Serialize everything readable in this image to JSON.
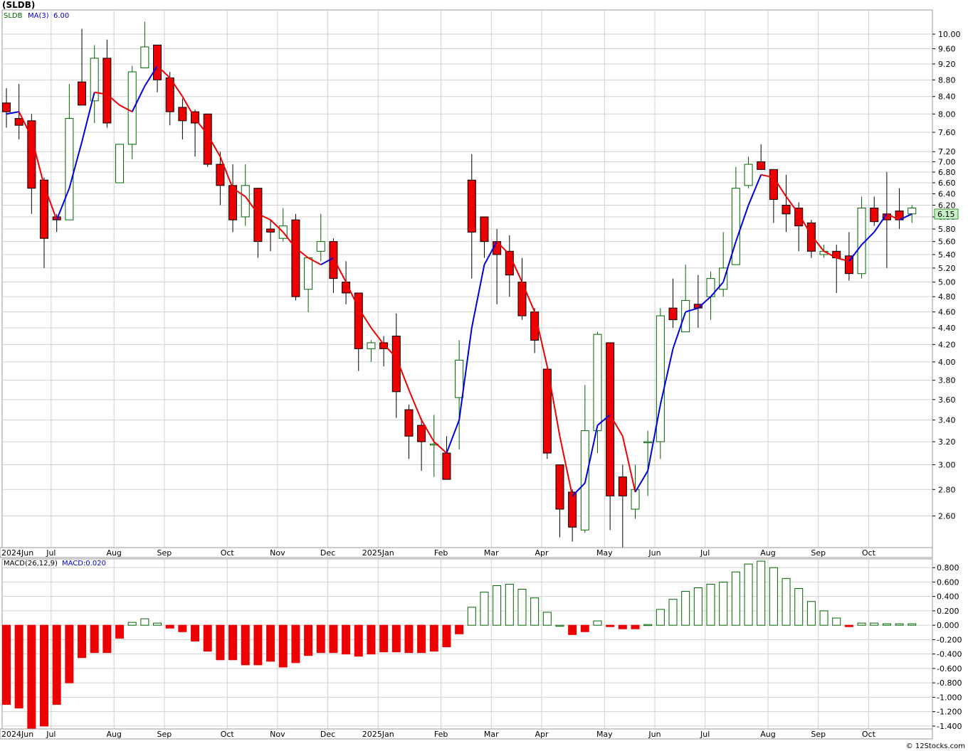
{
  "title": "(SLDB)",
  "credit": "© 12Stocks.com",
  "colors": {
    "up_stroke": "#006400",
    "down_fill": "#ee0000",
    "ma_up": "#0000dd",
    "ma_down": "#ee0000",
    "macd_text": "#0000cc",
    "grid": "#d0d0d0"
  },
  "months": [
    "2024Jun",
    "Jul",
    "Aug",
    "Sep",
    "Oct",
    "Nov",
    "Dec",
    "2025Jan",
    "Feb",
    "Mar",
    "Apr",
    "May",
    "Jun",
    "Jul",
    "Aug",
    "Sep",
    "Oct"
  ],
  "legend": {
    "symbol": "SLDB",
    "ma_label": "MA(3)",
    "ma_value": "6.00",
    "macd_label": "MACD(26,12,9)",
    "macd_value": "MACD:0.020"
  },
  "price_badge": "6.15",
  "chart_data": [
    {
      "type": "candlestick",
      "title": "(SLDB)",
      "y_scale": "log",
      "ylim": [
        2.38,
        10.7
      ],
      "y_ticks": [
        "10.00",
        "9.60",
        "9.20",
        "8.80",
        "8.40",
        "8.00",
        "7.60",
        "7.20",
        "7.00",
        "6.80",
        "6.60",
        "6.40",
        "6.20",
        "6.00",
        "5.80",
        "5.60",
        "5.40",
        "5.20",
        "5.00",
        "4.80",
        "4.60",
        "4.40",
        "4.20",
        "4.00",
        "3.80",
        "3.60",
        "3.40",
        "3.20",
        "3.00",
        "2.80",
        "2.60"
      ],
      "series_ma_name": "MA(3)",
      "candles": [
        {
          "date": "2024-06-03",
          "o": 8.25,
          "h": 8.6,
          "l": 7.7,
          "c": 8.05
        },
        {
          "date": "2024-06-10",
          "o": 7.9,
          "h": 8.7,
          "l": 7.45,
          "c": 7.75
        },
        {
          "date": "2024-06-17",
          "o": 7.85,
          "h": 8.0,
          "l": 6.05,
          "c": 6.5
        },
        {
          "date": "2024-06-24",
          "o": 6.65,
          "h": 6.7,
          "l": 5.2,
          "c": 5.65
        },
        {
          "date": "2024-07-01",
          "o": 6.0,
          "h": 6.05,
          "l": 5.75,
          "c": 5.95
        },
        {
          "date": "2024-07-08",
          "o": 5.95,
          "h": 8.7,
          "l": 5.95,
          "c": 7.9
        },
        {
          "date": "2024-07-15",
          "o": 8.75,
          "h": 10.15,
          "l": 8.2,
          "c": 8.2
        },
        {
          "date": "2024-07-22",
          "o": 8.3,
          "h": 9.7,
          "l": 7.8,
          "c": 9.35
        },
        {
          "date": "2024-07-29",
          "o": 9.35,
          "h": 9.85,
          "l": 7.7,
          "c": 7.8
        },
        {
          "date": "2024-08-05",
          "o": 6.6,
          "h": 7.35,
          "l": 6.6,
          "c": 7.35
        },
        {
          "date": "2024-08-12",
          "o": 7.35,
          "h": 9.15,
          "l": 7.05,
          "c": 9.0
        },
        {
          "date": "2024-08-19",
          "o": 9.1,
          "h": 10.35,
          "l": 9.1,
          "c": 9.65
        },
        {
          "date": "2024-08-26",
          "o": 9.7,
          "h": 9.7,
          "l": 8.5,
          "c": 8.8
        },
        {
          "date": "2024-09-02",
          "o": 8.85,
          "h": 9.0,
          "l": 7.75,
          "c": 8.05
        },
        {
          "date": "2024-09-09",
          "o": 8.15,
          "h": 8.35,
          "l": 7.45,
          "c": 7.85
        },
        {
          "date": "2024-09-16",
          "o": 8.05,
          "h": 8.1,
          "l": 7.1,
          "c": 7.8
        },
        {
          "date": "2024-09-23",
          "o": 8.0,
          "h": 8.0,
          "l": 6.9,
          "c": 6.95
        },
        {
          "date": "2024-09-30",
          "o": 6.95,
          "h": 7.2,
          "l": 6.2,
          "c": 6.55
        },
        {
          "date": "2024-10-07",
          "o": 6.55,
          "h": 6.95,
          "l": 5.75,
          "c": 5.95
        },
        {
          "date": "2024-10-14",
          "o": 6.0,
          "h": 6.95,
          "l": 5.85,
          "c": 6.55
        },
        {
          "date": "2024-10-21",
          "o": 6.5,
          "h": 6.5,
          "l": 5.35,
          "c": 5.6
        },
        {
          "date": "2024-10-28",
          "o": 5.8,
          "h": 5.95,
          "l": 5.45,
          "c": 5.75
        },
        {
          "date": "2024-11-04",
          "o": 5.65,
          "h": 6.15,
          "l": 5.6,
          "c": 5.85
        },
        {
          "date": "2024-11-11",
          "o": 5.95,
          "h": 6.05,
          "l": 4.75,
          "c": 4.8
        },
        {
          "date": "2024-11-18",
          "o": 4.9,
          "h": 5.3,
          "l": 4.6,
          "c": 5.35
        },
        {
          "date": "2024-11-25",
          "o": 5.45,
          "h": 6.05,
          "l": 5.3,
          "c": 5.6
        },
        {
          "date": "2024-12-02",
          "o": 5.6,
          "h": 5.65,
          "l": 4.85,
          "c": 5.05
        },
        {
          "date": "2024-12-09",
          "o": 5.0,
          "h": 5.3,
          "l": 4.7,
          "c": 4.85
        },
        {
          "date": "2024-12-16",
          "o": 4.85,
          "h": 4.85,
          "l": 3.9,
          "c": 4.15
        },
        {
          "date": "2024-12-23",
          "o": 4.15,
          "h": 4.25,
          "l": 4.0,
          "c": 4.22
        },
        {
          "date": "2024-12-30",
          "o": 4.22,
          "h": 4.3,
          "l": 3.95,
          "c": 4.15
        },
        {
          "date": "2025-01-06",
          "o": 4.3,
          "h": 4.58,
          "l": 3.42,
          "c": 3.68
        },
        {
          "date": "2025-01-13",
          "o": 3.5,
          "h": 3.55,
          "l": 3.05,
          "c": 3.25
        },
        {
          "date": "2025-01-20",
          "o": 3.35,
          "h": 3.42,
          "l": 2.95,
          "c": 3.2
        },
        {
          "date": "2025-01-27",
          "o": 3.17,
          "h": 3.45,
          "l": 2.9,
          "c": 3.18
        },
        {
          "date": "2025-02-03",
          "o": 3.1,
          "h": 3.25,
          "l": 2.88,
          "c": 2.88
        },
        {
          "date": "2025-02-10",
          "o": 3.62,
          "h": 4.25,
          "l": 3.13,
          "c": 4.02
        },
        {
          "date": "2025-02-17",
          "o": 6.65,
          "h": 7.15,
          "l": 5.05,
          "c": 5.75
        },
        {
          "date": "2025-02-24",
          "o": 6.0,
          "h": 6.0,
          "l": 5.35,
          "c": 5.6
        },
        {
          "date": "2025-03-03",
          "o": 5.6,
          "h": 5.8,
          "l": 4.7,
          "c": 5.4
        },
        {
          "date": "2025-03-10",
          "o": 5.45,
          "h": 5.7,
          "l": 4.8,
          "c": 5.1
        },
        {
          "date": "2025-03-17",
          "o": 5.0,
          "h": 5.35,
          "l": 4.5,
          "c": 4.55
        },
        {
          "date": "2025-03-24",
          "o": 4.6,
          "h": 4.65,
          "l": 4.1,
          "c": 4.25
        },
        {
          "date": "2025-03-31",
          "o": 3.92,
          "h": 3.92,
          "l": 3.05,
          "c": 3.1
        },
        {
          "date": "2025-04-07",
          "o": 3.0,
          "h": 3.0,
          "l": 2.45,
          "c": 2.65
        },
        {
          "date": "2025-04-14",
          "o": 2.78,
          "h": 2.8,
          "l": 2.42,
          "c": 2.52
        },
        {
          "date": "2025-04-21",
          "o": 2.5,
          "h": 3.75,
          "l": 2.48,
          "c": 3.3
        },
        {
          "date": "2025-04-28",
          "o": 3.3,
          "h": 4.35,
          "l": 3.1,
          "c": 4.32
        },
        {
          "date": "2025-05-05",
          "o": 4.22,
          "h": 4.22,
          "l": 2.5,
          "c": 2.75
        },
        {
          "date": "2025-05-12",
          "o": 2.9,
          "h": 3.0,
          "l": 2.38,
          "c": 2.75
        },
        {
          "date": "2025-05-19",
          "o": 2.65,
          "h": 3.0,
          "l": 2.58,
          "c": 2.8
        },
        {
          "date": "2025-05-26",
          "o": 3.2,
          "h": 3.3,
          "l": 2.75,
          "c": 3.2
        },
        {
          "date": "2025-06-02",
          "o": 3.2,
          "h": 4.65,
          "l": 3.05,
          "c": 4.55
        },
        {
          "date": "2025-06-09",
          "o": 4.65,
          "h": 5.05,
          "l": 4.4,
          "c": 4.5
        },
        {
          "date": "2025-06-16",
          "o": 4.35,
          "h": 5.25,
          "l": 4.35,
          "c": 4.75
        },
        {
          "date": "2025-06-23",
          "o": 4.7,
          "h": 5.1,
          "l": 4.4,
          "c": 4.65
        },
        {
          "date": "2025-06-30",
          "o": 4.8,
          "h": 5.15,
          "l": 4.5,
          "c": 5.05
        },
        {
          "date": "2025-07-07",
          "o": 4.9,
          "h": 5.75,
          "l": 4.8,
          "c": 5.2
        },
        {
          "date": "2025-07-14",
          "o": 5.25,
          "h": 6.9,
          "l": 5.25,
          "c": 6.5
        },
        {
          "date": "2025-07-21",
          "o": 6.55,
          "h": 7.1,
          "l": 6.5,
          "c": 6.95
        },
        {
          "date": "2025-07-28",
          "o": 7.0,
          "h": 7.35,
          "l": 6.85,
          "c": 6.85
        },
        {
          "date": "2025-08-04",
          "o": 6.85,
          "h": 6.85,
          "l": 5.9,
          "c": 6.3
        },
        {
          "date": "2025-08-11",
          "o": 6.2,
          "h": 6.75,
          "l": 5.75,
          "c": 6.05
        },
        {
          "date": "2025-08-18",
          "o": 6.15,
          "h": 6.25,
          "l": 5.45,
          "c": 5.85
        },
        {
          "date": "2025-08-25",
          "o": 5.9,
          "h": 5.95,
          "l": 5.35,
          "c": 5.45
        },
        {
          "date": "2025-09-01",
          "o": 5.4,
          "h": 5.55,
          "l": 5.35,
          "c": 5.45
        },
        {
          "date": "2025-09-08",
          "o": 5.45,
          "h": 5.55,
          "l": 4.85,
          "c": 5.35
        },
        {
          "date": "2025-09-15",
          "o": 5.38,
          "h": 5.75,
          "l": 5.02,
          "c": 5.12
        },
        {
          "date": "2025-09-22",
          "o": 5.12,
          "h": 6.35,
          "l": 5.05,
          "c": 6.15
        },
        {
          "date": "2025-09-29",
          "o": 6.15,
          "h": 6.35,
          "l": 5.85,
          "c": 5.92
        },
        {
          "date": "2025-10-06",
          "o": 6.05,
          "h": 6.8,
          "l": 5.2,
          "c": 5.95
        },
        {
          "date": "2025-10-13",
          "o": 6.1,
          "h": 6.5,
          "l": 5.8,
          "c": 5.95
        },
        {
          "date": "2025-10-20",
          "o": 6.05,
          "h": 6.2,
          "l": 5.9,
          "c": 6.15
        }
      ],
      "ma": [
        8.0,
        8.05,
        7.5,
        6.55,
        5.95,
        6.5,
        7.4,
        8.5,
        8.45,
        8.2,
        8.05,
        8.65,
        9.15,
        8.85,
        8.4,
        7.9,
        7.55,
        7.1,
        6.5,
        6.35,
        6.05,
        5.95,
        5.75,
        5.5,
        5.35,
        5.25,
        5.35,
        5.0,
        4.65,
        4.4,
        4.2,
        4.05,
        3.7,
        3.4,
        3.2,
        3.1,
        3.4,
        4.4,
        5.25,
        5.6,
        5.4,
        5.0,
        4.6,
        3.95,
        3.25,
        2.75,
        2.85,
        3.35,
        3.45,
        3.25,
        2.78,
        2.95,
        3.55,
        4.15,
        4.6,
        4.65,
        4.8,
        5.0,
        5.6,
        6.2,
        6.75,
        6.7,
        6.35,
        6.05,
        5.7,
        5.45,
        5.35,
        5.3,
        5.55,
        5.75,
        6.05,
        5.95,
        6.05
      ]
    },
    {
      "type": "bar",
      "title": "MACD(26,12,9)",
      "ylim": [
        -1.45,
        0.92
      ],
      "y_ticks": [
        "0.800",
        "0.600",
        "0.400",
        "0.200",
        "0.000",
        "-0.200",
        "-0.400",
        "-0.600",
        "-0.800",
        "-1.000",
        "-1.200",
        "-1.400"
      ],
      "values": [
        -1.1,
        -1.15,
        -1.45,
        -1.4,
        -1.1,
        -0.8,
        -0.45,
        -0.38,
        -0.38,
        -0.18,
        0.04,
        0.09,
        0.03,
        -0.04,
        -0.09,
        -0.22,
        -0.36,
        -0.48,
        -0.48,
        -0.55,
        -0.55,
        -0.5,
        -0.58,
        -0.52,
        -0.42,
        -0.38,
        -0.38,
        -0.4,
        -0.43,
        -0.4,
        -0.37,
        -0.37,
        -0.38,
        -0.38,
        -0.36,
        -0.3,
        -0.12,
        0.25,
        0.46,
        0.55,
        0.57,
        0.5,
        0.38,
        0.18,
        0.0,
        -0.13,
        -0.09,
        0.06,
        -0.02,
        -0.05,
        -0.05,
        0.01,
        0.22,
        0.36,
        0.47,
        0.52,
        0.57,
        0.6,
        0.74,
        0.85,
        0.89,
        0.8,
        0.65,
        0.51,
        0.33,
        0.2,
        0.1,
        -0.02,
        0.03,
        0.03,
        0.02,
        0.02,
        0.02
      ]
    }
  ]
}
